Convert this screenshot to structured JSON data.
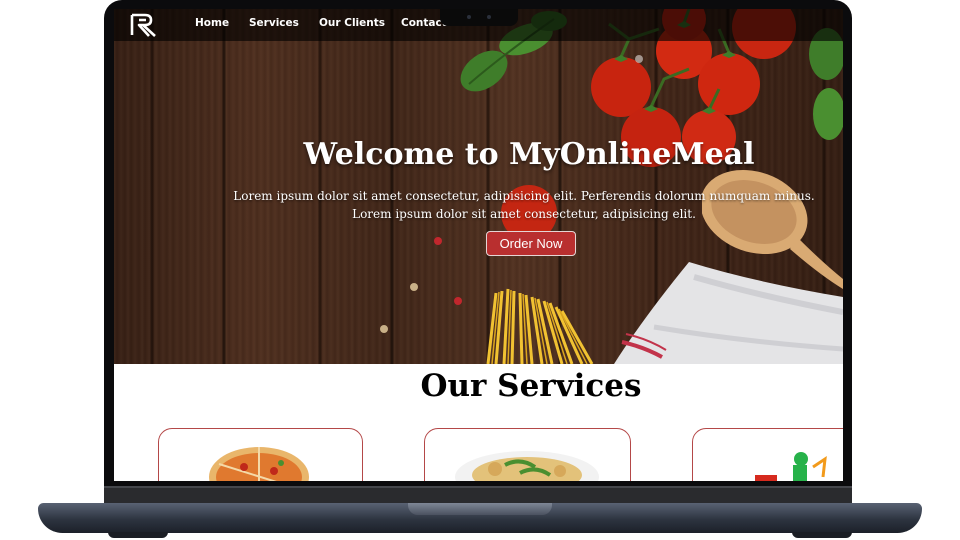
{
  "nav": {
    "items": [
      {
        "label": "Home"
      },
      {
        "label": "Services"
      },
      {
        "label": "Our Clients"
      },
      {
        "label": "Contact Us"
      }
    ]
  },
  "hero": {
    "title": "Welcome to MyOnlineMeal",
    "line1": "Lorem ipsum dolor sit amet consectetur, adipisicing elit. Perferendis dolorum numquam minus.",
    "line2": "Lorem ipsum dolor sit amet consectetur, adipisicing elit.",
    "order_button": "Order Now"
  },
  "services": {
    "title": "Our Services",
    "cards": [
      {
        "image": "pizza-image"
      },
      {
        "image": "pasta-dish-image"
      },
      {
        "image": "delivery-scooter-image"
      }
    ]
  },
  "colors": {
    "accent": "#b92f2f",
    "navbar": "#000000",
    "wood": "#4a2c1d"
  }
}
